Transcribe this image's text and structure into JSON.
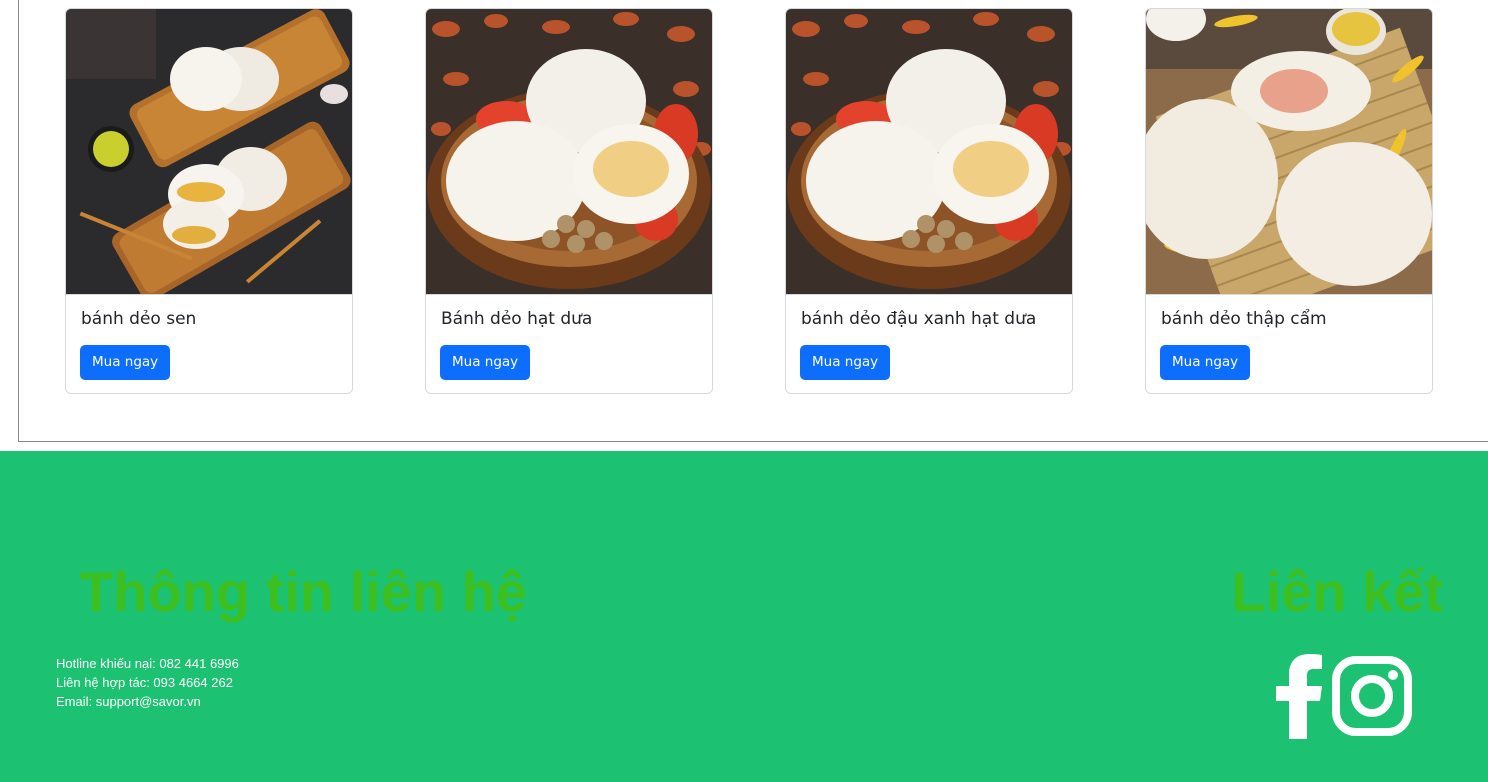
{
  "products": [
    {
      "name": "bánh dẻo sen",
      "button_label": "Mua ngay",
      "image": "mooncake-lotus-photo"
    },
    {
      "name": "Bánh dẻo hạt dưa",
      "button_label": "Mua ngay",
      "image": "mooncake-basket-photo"
    },
    {
      "name": "bánh dẻo đậu xanh hạt dưa",
      "button_label": "Mua ngay",
      "image": "mooncake-basket-photo"
    },
    {
      "name": "bánh dẻo thập cẩm",
      "button_label": "Mua ngay",
      "image": "mooncake-mixed-photo"
    }
  ],
  "footer": {
    "contact_title": "Thông tin liên hệ",
    "hotline": "Hotline khiếu nại: 082 441 6996",
    "partner": "Liên hệ hợp tác: 093 4664 262",
    "email": "Email: support@savor.vn",
    "links_title": "Liên kết",
    "social_icons": [
      "facebook-icon",
      "instagram-icon"
    ]
  },
  "colors": {
    "footer_bg": "#1cc272",
    "footer_heading": "#3cbf1f",
    "button": "#0d6efd"
  }
}
